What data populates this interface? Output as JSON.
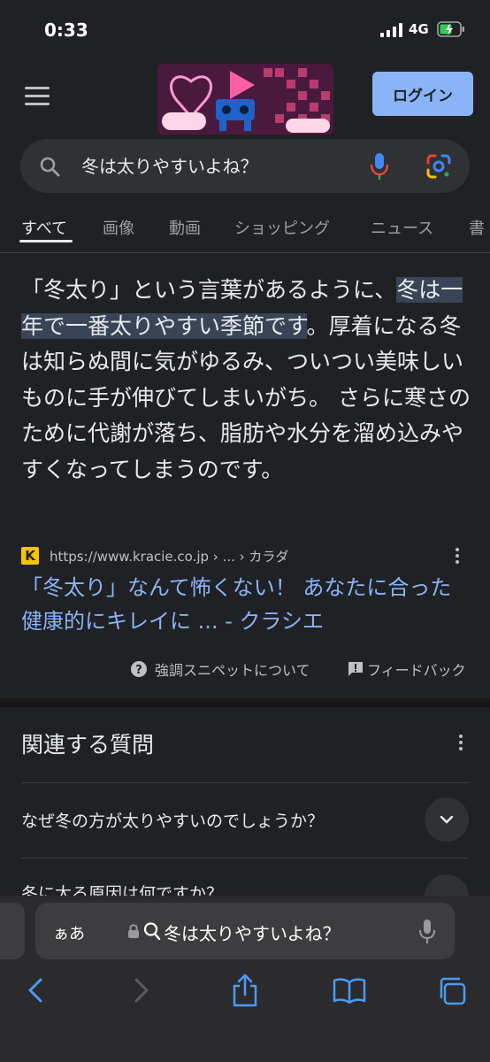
{
  "status_bar": {
    "time": "0:33",
    "network": "4G"
  },
  "header": {
    "login_label": "ログイン"
  },
  "search": {
    "query": "冬は太りやすいよね？"
  },
  "tabs": [
    "すべて",
    "画像",
    "動画",
    "ショッピング",
    "ニュース",
    "書"
  ],
  "snippet": {
    "before_highlight": "「冬太り」という言葉があるように、",
    "highlight": "冬は一年で一番太りやすい季節です",
    "after_highlight": "。厚着になる冬は知らぬ間に気がゆるみ、ついつい美味しいものに手が伸びてしまいがち。 さらに寒さのために代謝が落ち、脂肪や水分を溜め込みやすくなってしまうのです。",
    "favicon_letter": "K",
    "source_url": "https://www.kracie.co.jp › ... › カラダ",
    "result_title": "「冬太り」なんて怖くない！ あなたに合った健康的にキレイに ... - クラシエ",
    "about_label": "強調スニペットについて",
    "feedback_label": "フィードバック"
  },
  "related": {
    "title": "関連する質問",
    "questions": [
      "なぜ冬の方が太りやすいのでしょうか？",
      "冬に太る原因は何ですか？"
    ]
  },
  "browser": {
    "aa_label": "ぁあ",
    "address_text": "冬は太りやすいよね？"
  },
  "colors": {
    "background": "#202124",
    "link": "#8ab4f8",
    "highlight": "#394457",
    "button": "#8ab4f8"
  }
}
